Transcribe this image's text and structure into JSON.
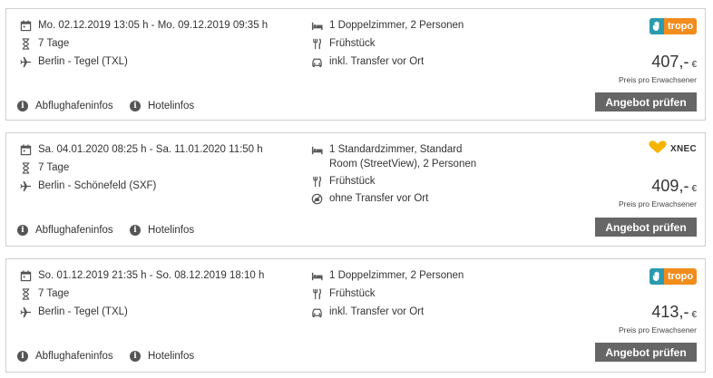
{
  "offers": [
    {
      "date_range": "Mo. 02.12.2019 13:05 h - Mo. 09.12.2019 09:35 h",
      "duration": "7 Tage",
      "airport": "Berlin - Tegel (TXL)",
      "room": "1 Doppelzimmer, 2 Personen",
      "board": "Frühstück",
      "transfer": "inkl. Transfer vor Ort",
      "price": "407,-",
      "currency": "€",
      "price_note": "Preis pro Erwachsener",
      "cta": "Angebot prüfen",
      "airport_info": "Abflughafeninfos",
      "hotel_info": "Hotelinfos",
      "operator_logo": "tropo",
      "transfer_icon": "car-icon"
    },
    {
      "date_range": "Sa. 04.01.2020 08:25 h - Sa. 11.01.2020 11:50 h",
      "duration": "7 Tage",
      "airport": "Berlin - Schönefeld (SXF)",
      "room": "1 Standardzimmer, Standard Room (StreetView), 2 Personen",
      "board": "Frühstück",
      "transfer": "ohne Transfer vor Ort",
      "price": "409,-",
      "currency": "€",
      "price_note": "Preis pro Erwachsener",
      "cta": "Angebot prüfen",
      "airport_info": "Abflughafeninfos",
      "hotel_info": "Hotelinfos",
      "operator_logo": "XNEC",
      "transfer_icon": "no-transfer-icon"
    },
    {
      "date_range": "So. 01.12.2019 21:35 h - So. 08.12.2019 18:10 h",
      "duration": "7 Tage",
      "airport": "Berlin - Tegel (TXL)",
      "room": "1 Doppelzimmer, 2 Personen",
      "board": "Frühstück",
      "transfer": "inkl. Transfer vor Ort",
      "price": "413,-",
      "currency": "€",
      "price_note": "Preis pro Erwachsener",
      "cta": "Angebot prüfen",
      "airport_info": "Abflughafeninfos",
      "hotel_info": "Hotelinfos",
      "operator_logo": "tropo",
      "transfer_icon": "car-icon"
    }
  ],
  "colors": {
    "button_bg": "#666666",
    "tropo_orange": "#f28c1c",
    "tropo_teal": "#2b9bb0",
    "xnec_yellow": "#f5b400",
    "border": "#cfcfcf"
  }
}
